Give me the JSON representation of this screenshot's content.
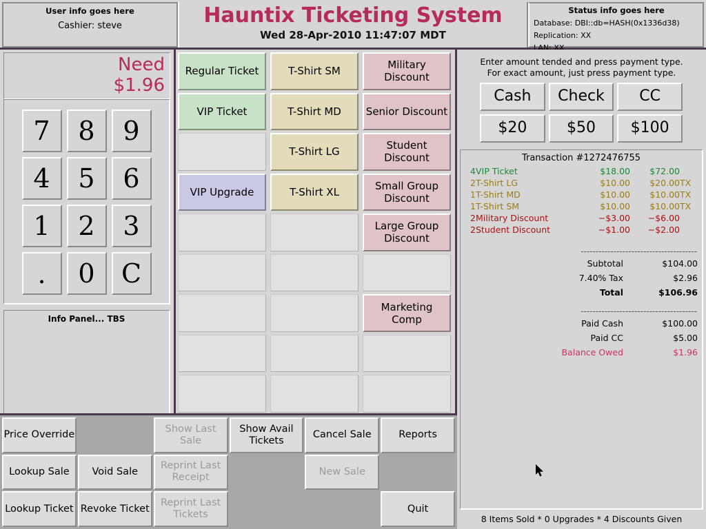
{
  "header": {
    "user_panel": {
      "title": "User info goes here",
      "cashier": "Cashier: steve"
    },
    "app_title": "Hauntix Ticketing System",
    "datetime": "Wed 28-Apr-2010 11:47:07 MDT",
    "status_panel": {
      "title": "Status info goes here",
      "database": "Database: DBI::db=HASH(0x1336d38)",
      "replication": "Replication: XX",
      "lan": "LAN: XX"
    }
  },
  "left": {
    "need_label": "Need",
    "need_amount": "$1.96",
    "keypad": [
      "7",
      "8",
      "9",
      "4",
      "5",
      "6",
      "1",
      "2",
      "3",
      ".",
      "0",
      "C"
    ],
    "info_panel": "Info Panel... TBS"
  },
  "products": [
    {
      "label": "Regular Ticket",
      "style": "green"
    },
    {
      "label": "T-Shirt SM",
      "style": "tan"
    },
    {
      "label": "Military Discount",
      "style": "pink"
    },
    {
      "label": "VIP Ticket",
      "style": "green"
    },
    {
      "label": "T-Shirt MD",
      "style": "tan"
    },
    {
      "label": "Senior Discount",
      "style": "pink"
    },
    {
      "label": "",
      "style": "empty"
    },
    {
      "label": "T-Shirt LG",
      "style": "tan"
    },
    {
      "label": "Student Discount",
      "style": "pink"
    },
    {
      "label": "VIP Upgrade",
      "style": "purple"
    },
    {
      "label": "T-Shirt XL",
      "style": "tan"
    },
    {
      "label": "Small Group Discount",
      "style": "pink"
    },
    {
      "label": "",
      "style": "empty"
    },
    {
      "label": "",
      "style": "empty"
    },
    {
      "label": "Large Group Discount",
      "style": "pink"
    },
    {
      "label": "",
      "style": "empty"
    },
    {
      "label": "",
      "style": "empty"
    },
    {
      "label": "",
      "style": "empty"
    },
    {
      "label": "",
      "style": "empty"
    },
    {
      "label": "",
      "style": "empty"
    },
    {
      "label": "Marketing Comp",
      "style": "pink"
    },
    {
      "label": "",
      "style": "empty"
    },
    {
      "label": "",
      "style": "empty"
    },
    {
      "label": "",
      "style": "empty"
    },
    {
      "label": "",
      "style": "empty"
    },
    {
      "label": "",
      "style": "empty"
    },
    {
      "label": "",
      "style": "empty"
    }
  ],
  "payment": {
    "hint_line1": "Enter amount tended and press payment type.",
    "hint_line2": "For exact amount, just press payment type.",
    "buttons": [
      "Cash",
      "Check",
      "CC",
      "$20",
      "$50",
      "$100"
    ]
  },
  "transaction": {
    "title": "Transaction #1272476755",
    "lines": [
      {
        "qty": "4",
        "desc": "VIP Ticket",
        "unit": "$18.00",
        "ext": "$72.00",
        "tax": "",
        "color": "green"
      },
      {
        "qty": "2",
        "desc": "T-Shirt LG",
        "unit": "$10.00",
        "ext": "$20.00",
        "tax": "TX",
        "color": "tan"
      },
      {
        "qty": "1",
        "desc": "T-Shirt MD",
        "unit": "$10.00",
        "ext": "$10.00",
        "tax": "TX",
        "color": "tan"
      },
      {
        "qty": "1",
        "desc": "T-Shirt SM",
        "unit": "$10.00",
        "ext": "$10.00",
        "tax": "TX",
        "color": "tan"
      },
      {
        "qty": "2",
        "desc": "Military Discount",
        "unit": "−$3.00",
        "ext": "−$6.00",
        "tax": "",
        "color": "red"
      },
      {
        "qty": "2",
        "desc": "Student Discount",
        "unit": "−$1.00",
        "ext": "−$2.00",
        "tax": "",
        "color": "red"
      }
    ],
    "divider": "---------------------------------------",
    "totals": [
      {
        "label": "Subtotal",
        "value": "$104.00",
        "style": ""
      },
      {
        "label": "7.40% Tax",
        "value": "$2.96",
        "style": ""
      },
      {
        "label": "Total",
        "value": "$106.96",
        "style": "bold"
      }
    ],
    "payments": [
      {
        "label": "Paid Cash",
        "value": "$100.00",
        "style": ""
      },
      {
        "label": "Paid CC",
        "value": "$5.00",
        "style": ""
      },
      {
        "label": "Balance Owed",
        "value": "$1.96",
        "style": "owed"
      }
    ],
    "status_line": "8 Items Sold * 0 Upgrades * 4 Discounts Given"
  },
  "toolbar": [
    {
      "label": "Price Override",
      "state": "enabled"
    },
    {
      "label": "",
      "state": "blank"
    },
    {
      "label": "Show Last Sale",
      "state": "disabled"
    },
    {
      "label": "Show Avail Tickets",
      "state": "enabled"
    },
    {
      "label": "Cancel Sale",
      "state": "enabled"
    },
    {
      "label": "Reports",
      "state": "enabled"
    },
    {
      "label": "Lookup Sale",
      "state": "enabled"
    },
    {
      "label": "Void Sale",
      "state": "enabled"
    },
    {
      "label": "Reprint Last Receipt",
      "state": "disabled"
    },
    {
      "label": "",
      "state": "blank"
    },
    {
      "label": "New Sale",
      "state": "disabled"
    },
    {
      "label": "",
      "state": "blank"
    },
    {
      "label": "Lookup Ticket",
      "state": "enabled"
    },
    {
      "label": "Revoke Ticket",
      "state": "enabled"
    },
    {
      "label": "Reprint Last Tickets",
      "state": "disabled"
    },
    {
      "label": "",
      "state": "blank"
    },
    {
      "label": "",
      "state": "blank"
    },
    {
      "label": "Quit",
      "state": "enabled"
    }
  ],
  "colors": {
    "brand": "#b62a5c",
    "ticket": "#c7e2c6",
    "merch": "#e2dcba",
    "discount": "#e0c3c6",
    "upgrade": "#c9c9e6",
    "owed": "#cc3366"
  }
}
